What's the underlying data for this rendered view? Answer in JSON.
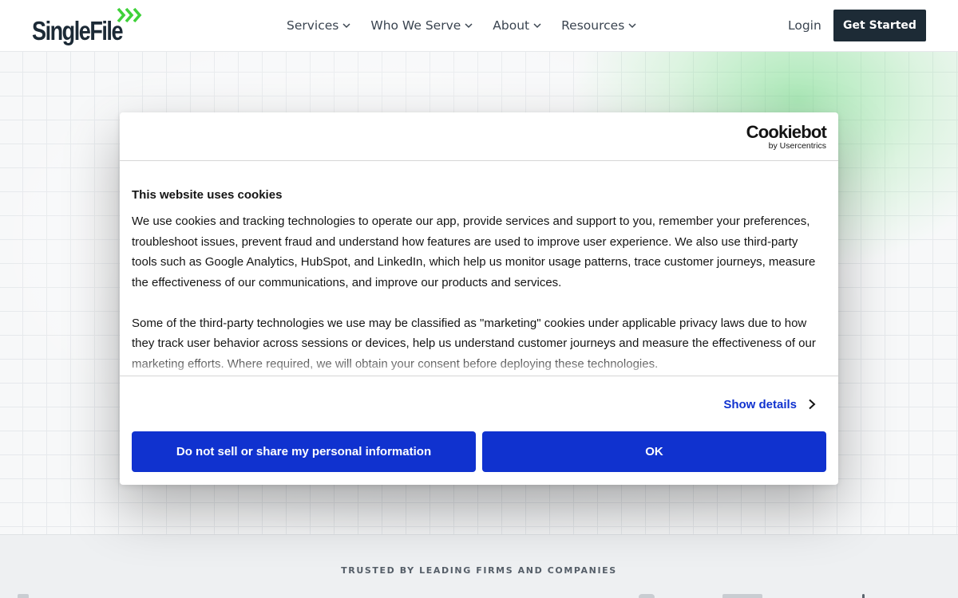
{
  "header": {
    "logo_text": "SingleFile",
    "nav": [
      {
        "label": "Services"
      },
      {
        "label": "Who We Serve"
      },
      {
        "label": "About"
      },
      {
        "label": "Resources"
      }
    ],
    "login_label": "Login",
    "cta_label": "Get Started"
  },
  "cookie_dialog": {
    "brand_name": "Cookiebot",
    "brand_byline": "by Usercentrics",
    "title": "This website uses cookies",
    "paragraphs": [
      "We use cookies and tracking technologies to operate our app, provide services and support to you, remember your preferences, troubleshoot issues, prevent fraud and understand how features are used to improve user experience. We also use third-party tools such as Google Analytics, HubSpot, and LinkedIn, which help us monitor usage patterns, trace customer journeys, measure the effectiveness of our communications, and improve our products and services.",
      "Some of the third-party technologies we use may be classified as \"marketing\" cookies under applicable privacy laws due to how they track user behavior across sessions or devices, help us understand customer journeys and measure the effectiveness of our marketing efforts. Where required, we will obtain your consent before deploying these technologies."
    ],
    "show_details_label": "Show details",
    "decline_label": "Do not sell or share my personal information",
    "ok_label": "OK"
  },
  "trusted": {
    "label": "TRUSTED BY LEADING FIRMS AND COMPANIES"
  },
  "colors": {
    "brand_dark": "#1d2b36",
    "brand_green": "#3fd13a",
    "dialog_button": "#1032cf",
    "grid_line": "#e6e9ec"
  },
  "icons": {
    "logo_mark": "triple-chevron-right-icon",
    "nav_dropdown": "chevron-down-icon",
    "show_details": "chevron-right-icon"
  }
}
